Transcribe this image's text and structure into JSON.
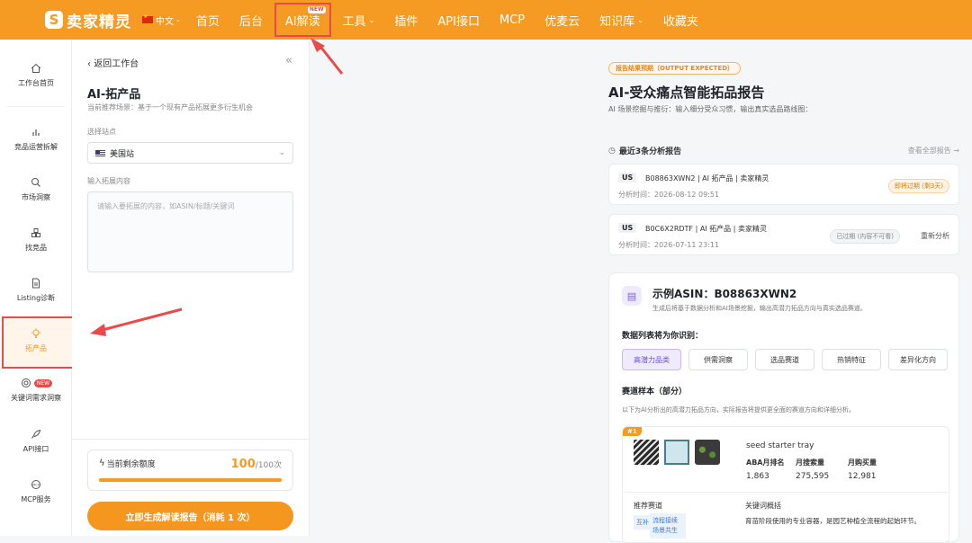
{
  "topbar": {
    "logo_text": "卖家精灵",
    "lang": "中文",
    "nav": [
      {
        "label": "首页",
        "caret": false
      },
      {
        "label": "后台",
        "caret": false
      },
      {
        "label": "AI解读",
        "caret": false,
        "badge": "NEW"
      },
      {
        "label": "工具",
        "caret": true
      },
      {
        "label": "插件",
        "caret": false
      },
      {
        "label": "API接口",
        "caret": false
      },
      {
        "label": "MCP",
        "caret": false
      },
      {
        "label": "优麦云",
        "caret": false
      },
      {
        "label": "知识库",
        "caret": true
      },
      {
        "label": "收藏夹",
        "caret": false
      }
    ]
  },
  "iconbar": {
    "items": [
      {
        "label": "工作台首页",
        "icon": "home-icon"
      },
      {
        "label": "竞品运营拆解",
        "icon": "bar-chart-icon"
      },
      {
        "label": "市场洞察",
        "icon": "search-icon"
      },
      {
        "label": "找竞品",
        "icon": "boxes-icon"
      },
      {
        "label": "Listing诊断",
        "icon": "document-icon"
      },
      {
        "label": "拓产品",
        "icon": "bulb-icon"
      },
      {
        "label": "关键词需求洞察",
        "icon": "target-icon",
        "badge": "NEW"
      },
      {
        "label": "API接口",
        "icon": "rocket-icon"
      },
      {
        "label": "MCP服务",
        "icon": "mcp-icon"
      }
    ]
  },
  "panel": {
    "back": "返回工作台",
    "title": "AI-拓产品",
    "subtitle": "当前推荐场景：基于一个现有产品拓展更多衍生机会",
    "site_label": "选择站点",
    "site_value": "美国站",
    "input_label": "输入拓展内容",
    "input_placeholder": "请输入要拓展的内容，如ASIN/标题/关键词",
    "quota_label": "当前剩余额度",
    "quota_value": "100",
    "quota_total": "/100次",
    "quota_fraction": 1.0,
    "generate_button": "立即生成解读报告（消耗 1 次）"
  },
  "report": {
    "output_tag": "报告结果预期（OUTPUT EXPECTED）",
    "title": "AI-受众痛点智能拓品报告",
    "subtitle": "AI 场景挖掘与推衍：输入细分受众习惯，输出真实选品路线图：",
    "recent_head": "最近3条分析报告",
    "view_all": "查看全部报告 →",
    "recent": [
      {
        "country": "US",
        "title": "B08863XWN2 | AI 拓产品 | 卖家精灵",
        "time": "分析时间：2026-08-12 09:51",
        "status": "即将过期 (剩3天)",
        "action": ""
      },
      {
        "country": "US",
        "title": "B0C6X2RDTF | AI 拓产品 | 卖家精灵",
        "time": "分析时间：2026-07-11 23:11",
        "status": "已过期 (内容不可看)",
        "action": "重新分析"
      }
    ],
    "example_title": "示例ASIN：B08863XWN2",
    "example_sub": "生成后将基于数据分析和AI场景挖掘，输出高潜力拓品方向与真实选品赛道。",
    "data_head": "数据列表将为你识别：",
    "chips": [
      "高潜力品类",
      "供需洞察",
      "选品赛道",
      "热销特征",
      "差异化方向"
    ],
    "track_head": "赛道样本（部分）",
    "track_sub": "以下为AI分析出的高潜力拓品方向，实际报告将提供更全面的赛道方向和详细分析。",
    "product": {
      "rank": "#1",
      "name": "seed starter tray",
      "metrics": [
        {
          "label": "ABA月排名",
          "value": "1,863"
        },
        {
          "label": "月搜索量",
          "value": "275,595"
        },
        {
          "label": "月购买量",
          "value": "12,981"
        }
      ],
      "rec_label": "推荐赛道",
      "kw_label": "关键词概括",
      "tag_mini": "互补",
      "tag_rel": "流程接续场景共生",
      "kw_text": "育苗阶段使用的专业容器，是园艺种植全流程的起始环节。"
    }
  }
}
